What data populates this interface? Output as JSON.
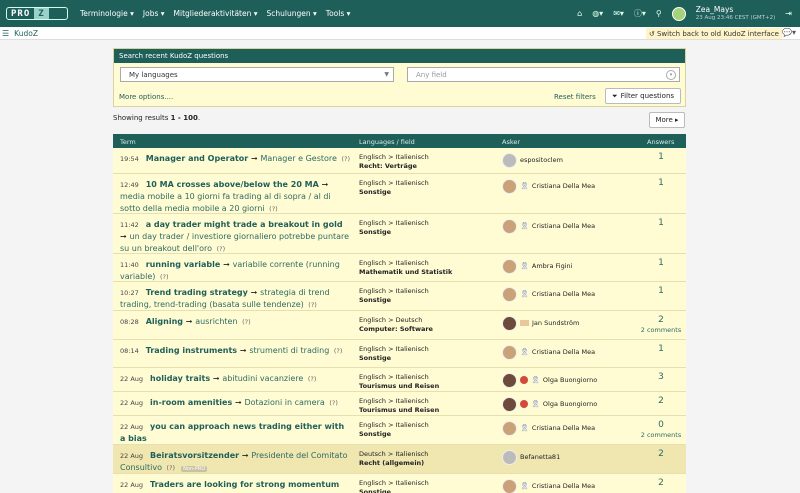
{
  "nav": {
    "logo_left": "PRO",
    "logo_right": "Z",
    "menu": [
      "Terminologie ▾",
      "Jobs ▾",
      "Mitgliederaktivitäten ▾",
      "Schulungen ▾",
      "Tools ▾"
    ],
    "icons": [
      "home-icon",
      "globe-icon",
      "mail-icon",
      "help-icon",
      "search-icon"
    ],
    "user_name": "Zea_Mays",
    "user_time": "23 Aug 23:46 CEST (GMT+2)"
  },
  "subbar": {
    "title": "KudoZ",
    "switch_back": "Switch back to old KudoZ interface"
  },
  "search": {
    "header": "Search recent KudoZ questions",
    "language_value": "My languages",
    "field_placeholder": "Any field",
    "more_options": "More options....",
    "reset": "Reset filters",
    "filter_button": "Filter questions"
  },
  "results": {
    "showing_prefix": "Showing results",
    "range": "1 - 100",
    "more_button": "More ▸"
  },
  "table": {
    "headers": {
      "term": "Term",
      "languages": "Languages / field",
      "asker": "Asker",
      "answers": "Answers"
    },
    "rows": [
      {
        "time": "19:54",
        "source": "Manager and Operator",
        "target": "Manager e Gestore",
        "q": "(?)",
        "pair": "Englisch > Italienisch",
        "field": "Recht: Verträge",
        "asker": "espositoclem",
        "answers": "1",
        "comments": ""
      },
      {
        "time": "12:49",
        "source": "10 MA crosses above/below the 20 MA",
        "target": "media mobile a 10 giorni fa trading al di sopra / al di sotto della media mobile a 20 giorni",
        "q": "(?)",
        "pair": "Englisch > Italienisch",
        "field": "Sonstige",
        "asker": "Cristiana Della Mea",
        "answers": "1",
        "comments": ""
      },
      {
        "time": "11:42",
        "source": "a day trader might trade a breakout in gold",
        "target": "un day trader / investiore giornaliero potrebbe puntare su un breakout dell'oro",
        "q": "(?)",
        "pair": "Englisch > Italienisch",
        "field": "Sonstige",
        "asker": "Cristiana Della Mea",
        "answers": "1",
        "comments": ""
      },
      {
        "time": "11:40",
        "source": "running variable",
        "target": "variabile corrente (running variable)",
        "q": "(?)",
        "pair": "Englisch > Italienisch",
        "field": "Mathematik und Statistik",
        "asker": "Ambra Figini",
        "answers": "1",
        "comments": ""
      },
      {
        "time": "10:27",
        "source": "Trend trading strategy",
        "target": "strategia di trend trading, trend-trading (basata sulle tendenze)",
        "q": "(?)",
        "pair": "Englisch > Italienisch",
        "field": "Sonstige",
        "asker": "Cristiana Della Mea",
        "answers": "1",
        "comments": ""
      },
      {
        "time": "08:28",
        "source": "Aligning",
        "target": "ausrichten",
        "q": "(?)",
        "pair": "Englisch > Deutsch",
        "field": "Computer: Software",
        "asker": "Jan Sundström",
        "answers": "2",
        "comments": "2 comments"
      },
      {
        "time": "08:14",
        "source": "Trading instruments",
        "target": "strumenti di trading",
        "q": "(?)",
        "pair": "Englisch > Italienisch",
        "field": "Sonstige",
        "asker": "Cristiana Della Mea",
        "answers": "1",
        "comments": ""
      },
      {
        "time": "22 Aug",
        "source": "holiday traits",
        "target": "abitudini vacanziere",
        "q": "(?)",
        "pair": "Englisch > Italienisch",
        "field": "Tourismus und Reisen",
        "asker": "Olga Buongiorno",
        "answers": "3",
        "comments": ""
      },
      {
        "time": "22 Aug",
        "source": "in-room amenities",
        "target": "Dotazioni in camera",
        "q": "(?)",
        "pair": "Englisch > Italienisch",
        "field": "Tourismus und Reisen",
        "asker": "Olga Buongiorno",
        "answers": "2",
        "comments": ""
      },
      {
        "time": "22 Aug",
        "source": "you can approach news trading either with a bias",
        "target": "",
        "q": "",
        "pair": "Englisch > Italienisch",
        "field": "Sonstige",
        "asker": "Cristiana Della Mea",
        "answers": "0",
        "comments": "2 comments"
      },
      {
        "time": "22 Aug",
        "source": "Beiratsvorsitzender",
        "target": "Presidente del Comitato Consultivo",
        "q": "(?)",
        "np": "Non-PRO",
        "pair": "Deutsch > Italienisch",
        "field": "Recht (allgemein)",
        "asker": "Befanetta81",
        "answers": "2",
        "comments": ""
      },
      {
        "time": "22 Aug",
        "source": "Traders are looking for strong momentum",
        "target": "",
        "q": "",
        "pair": "Englisch > Italienisch",
        "field": "Sonstige",
        "asker": "Cristiana Della Mea",
        "answers": "2",
        "comments": ""
      }
    ]
  },
  "colors": {
    "nav": "#1f5f5a",
    "row_bg": "#fffcd4",
    "row_highlight": "#efe6b0",
    "link": "#2e6b62"
  }
}
